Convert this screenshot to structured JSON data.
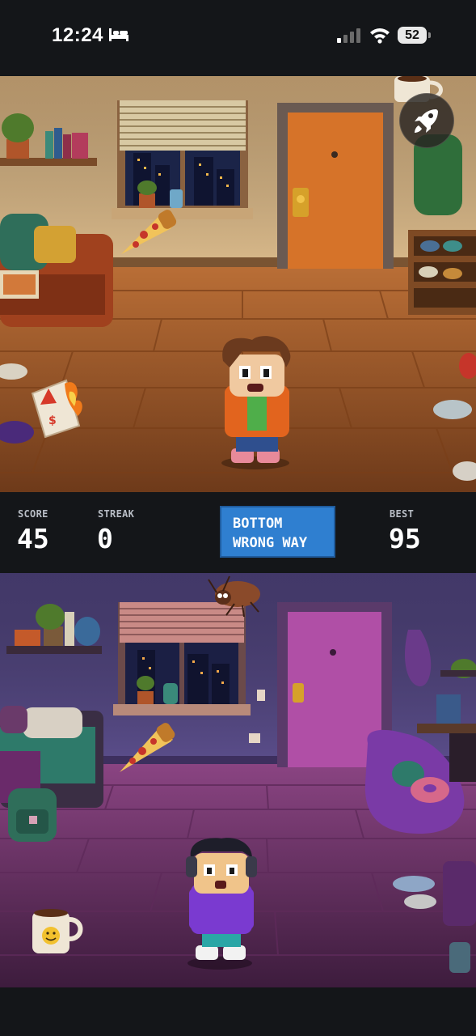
{
  "status_bar": {
    "time": "12:24",
    "battery": "52",
    "icons": [
      "bed-icon",
      "cellular-signal-icon",
      "wifi-icon",
      "battery-icon"
    ]
  },
  "hud": {
    "score_label": "SCORE",
    "score_value": "45",
    "streak_label": "STREAK",
    "streak_value": "0",
    "direction_line1": "BOTTOM",
    "direction_line2": "WRONG WAY",
    "best_label": "BEST",
    "best_value": "95"
  },
  "colors": {
    "accent_blue": "#2f7fd0",
    "top_room_wall": "#d9b98a",
    "top_room_floor": "#a9602c",
    "top_door": "#e27a2c",
    "bottom_room_wall": "#5a4d8a",
    "bottom_room_floor": "#7a3a73",
    "bottom_door": "#b04fa6",
    "hud_background": "#141619"
  },
  "scenes": {
    "top": {
      "room": "warm-living-room",
      "character": "boy-orange-hoodie",
      "items": [
        "pizza-slice",
        "burning-bill",
        "coffee-mug",
        "couch",
        "door",
        "window",
        "shoe-rack"
      ]
    },
    "bottom": {
      "room": "purple-bedroom",
      "character": "kid-headphones-purple-hoodie",
      "items": [
        "pizza-slice",
        "cockroach",
        "smiley-coffee-mug",
        "bed",
        "door",
        "window",
        "bean-bag-chair",
        "donut",
        "backpack"
      ]
    }
  },
  "controls": {
    "boost_icon": "rocket-icon"
  }
}
